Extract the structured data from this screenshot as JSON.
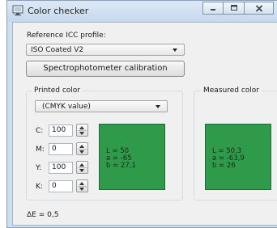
{
  "window": {
    "title": "Color checker",
    "icon": "monitor-icon"
  },
  "caption_buttons": {
    "minimize": "minimize-icon",
    "maximize": "maximize-icon",
    "close": "close-icon"
  },
  "reference": {
    "label": "Reference ICC profile:",
    "selected": "ISO Coated V2",
    "calibration_button": "Spectrophotometer calibration"
  },
  "printed": {
    "group_title": "Printed color",
    "mode_selected": "(CMYK value)",
    "fields": [
      {
        "label": "C:",
        "value": "100"
      },
      {
        "label": "M:",
        "value": "0"
      },
      {
        "label": "Y:",
        "value": "100"
      },
      {
        "label": "K:",
        "value": "0"
      }
    ],
    "swatch_color": "#2e9a4a",
    "lab": {
      "L": "L = 50",
      "a": "a = -65",
      "b": "b = 27,1"
    }
  },
  "measured": {
    "group_title": "Measured color",
    "swatch_color": "#2e9a4a",
    "lab": {
      "L": "L = 50,3",
      "a": "a = -63,9",
      "b": "b = 26"
    }
  },
  "delta_e": "ΔE = 0,5"
}
